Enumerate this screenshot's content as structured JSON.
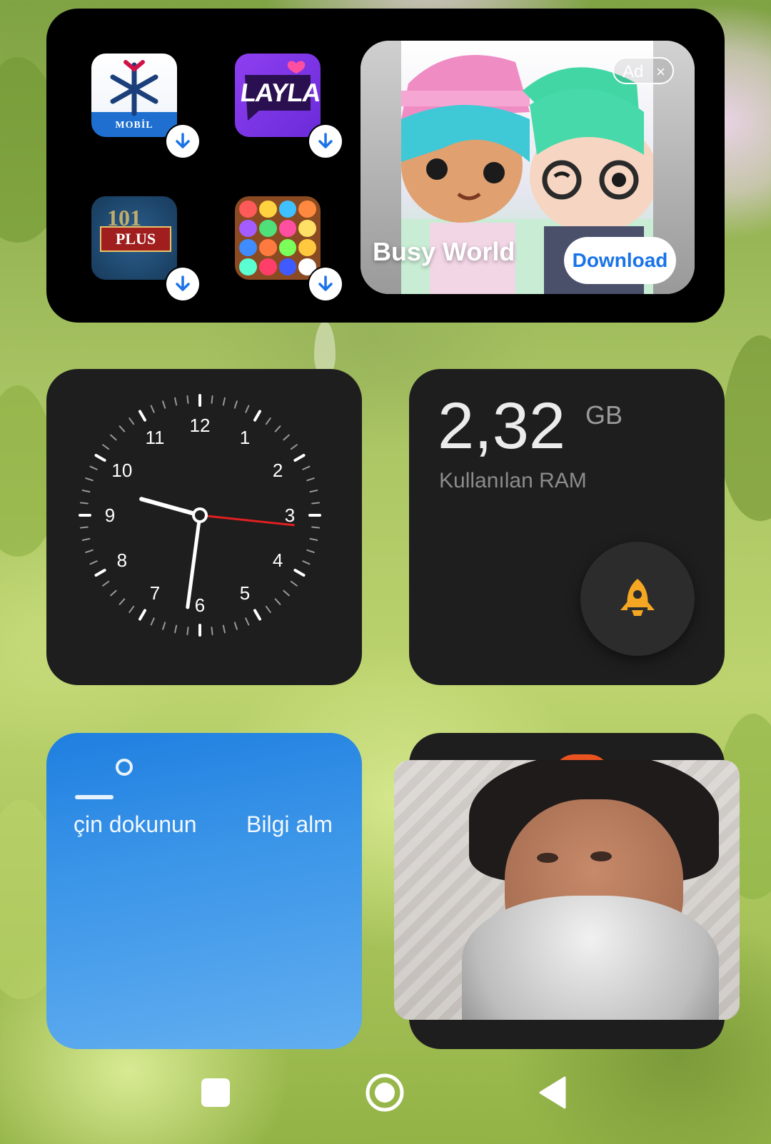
{
  "ad_widget": {
    "apps": [
      {
        "name": "MOBİL"
      },
      {
        "name": "LAYLA"
      },
      {
        "name": "PLUS",
        "badge_number": "101"
      },
      {
        "name": ""
      }
    ],
    "ad": {
      "badge": "Ad",
      "close": "×",
      "title": "Busy World",
      "button": "Download"
    }
  },
  "clock": {
    "numbers": [
      "12",
      "1",
      "2",
      "3",
      "4",
      "5",
      "6",
      "7",
      "8",
      "9",
      "10",
      "11"
    ],
    "time": {
      "hour": 9,
      "minute": 31,
      "second": 16
    }
  },
  "ram": {
    "value": "2,32",
    "unit": "GB",
    "label": "Kullanılan RAM",
    "icon": "rocket-icon",
    "accent": "#f5a623"
  },
  "weather": {
    "text_left": "çin dokunun",
    "text_right": "Bilgi alm",
    "temperature": "—"
  },
  "colors": {
    "widget_dark": "#1e1e1e",
    "ad_button_text": "#1a73e8",
    "second_hand": "#e02020"
  },
  "navigation": {
    "recents": "square-icon",
    "home": "circle-icon",
    "back": "triangle-back-icon"
  }
}
